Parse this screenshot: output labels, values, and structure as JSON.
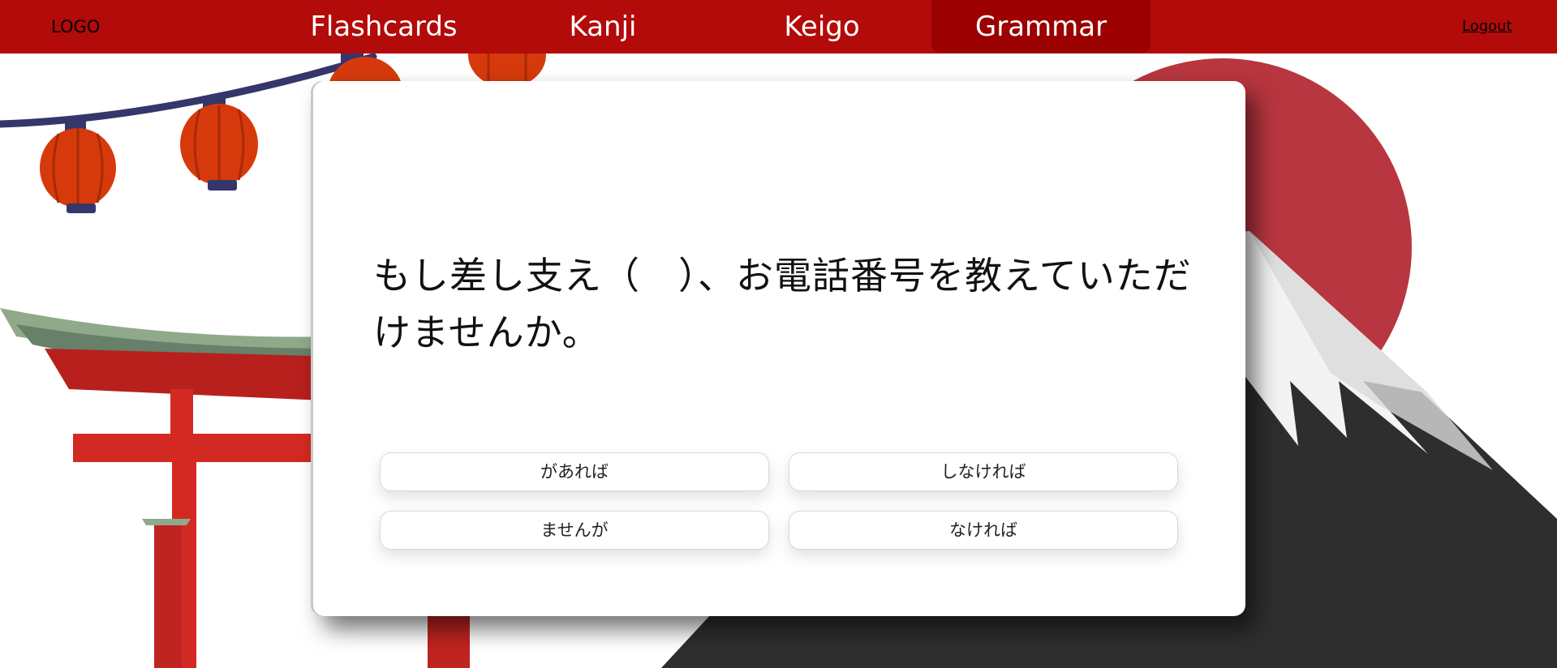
{
  "nav": {
    "logo": "LOGO",
    "items": [
      {
        "label": "Flashcards",
        "active": false
      },
      {
        "label": "Kanji",
        "active": false
      },
      {
        "label": "Keigo",
        "active": false
      },
      {
        "label": "Grammar",
        "active": true
      }
    ],
    "logout": "Logout"
  },
  "quiz": {
    "question": "もし差し支え（　）、お電話番号を教えていただけませんか。",
    "answers": [
      "があれば",
      "しなければ",
      "ませんが",
      "なければ"
    ]
  },
  "colors": {
    "nav_bg": "#b30a0a",
    "nav_active_bg": "#9b0101",
    "sun": "#b8363f",
    "mountain": "#2e2e2e",
    "torii": "#d22a22",
    "lantern": "#d63a0c"
  }
}
